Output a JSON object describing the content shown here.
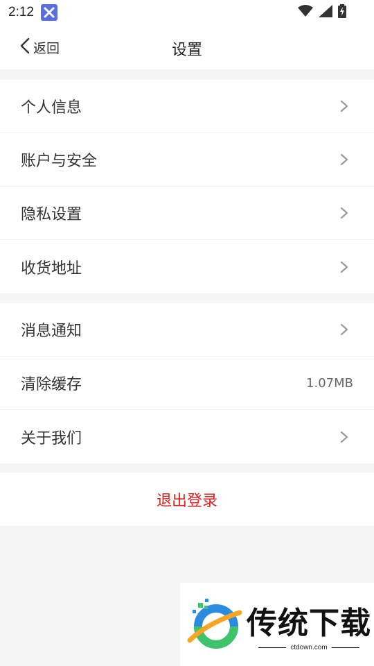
{
  "status_bar": {
    "time": "2:12",
    "icons": [
      "app-notification-icon",
      "wifi-icon",
      "signal-icon",
      "battery-charging-icon"
    ]
  },
  "nav": {
    "back_label": "返回",
    "title": "设置"
  },
  "groups": [
    {
      "items": [
        {
          "label": "个人信息",
          "icon": "chevron-right-icon"
        },
        {
          "label": "账户与安全",
          "icon": "chevron-right-icon"
        },
        {
          "label": "隐私设置",
          "icon": "chevron-right-icon"
        },
        {
          "label": "收货地址",
          "icon": "chevron-right-icon"
        }
      ]
    },
    {
      "items": [
        {
          "label": "消息通知",
          "icon": "chevron-right-icon"
        },
        {
          "label": "清除缓存",
          "value": "1.07MB"
        },
        {
          "label": "关于我们",
          "icon": "chevron-right-icon"
        }
      ]
    }
  ],
  "logout_label": "退出登录",
  "watermark": {
    "name": "传统下载",
    "domain": "ctdown.com"
  },
  "colors": {
    "background": "#f5f5f5",
    "surface": "#ffffff",
    "logout_red": "#e02020",
    "chevron": "#999999"
  }
}
